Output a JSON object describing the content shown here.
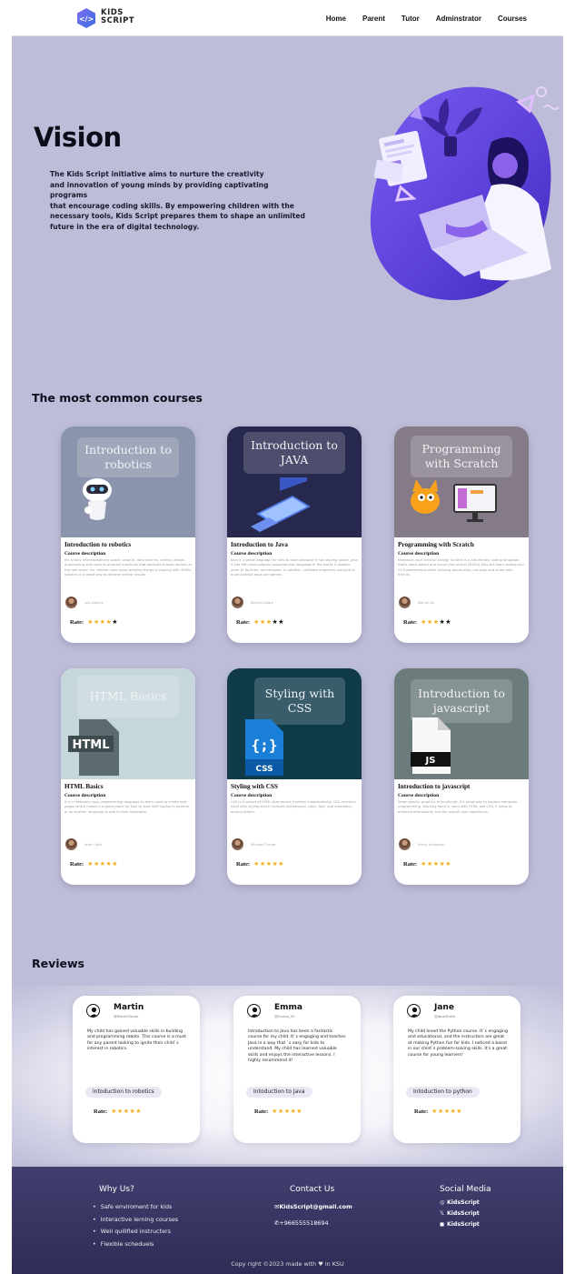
{
  "header": {
    "brand_line1": "KIDS",
    "brand_line2": "SCRIPT",
    "nav": [
      "Home",
      "Parent",
      "Tutor",
      "Adminstrator",
      "Courses"
    ]
  },
  "hero": {
    "title": "Vision",
    "text_lines": [
      "The Kids Script initiative aims to nurture the creativity",
      "and innovation of young minds by providing captivating",
      "programs",
      "that encourage coding skills. By empowering children with the",
      "necessary tools, Kids Script prepares them to shape an unlimited",
      "future in the era of digital technology."
    ]
  },
  "courses": {
    "section_title": "The most common courses",
    "items": [
      {
        "thumb_text": "Introduction to robotics",
        "title": "Introduction to robotics",
        "subtitle": "Course description",
        "description": "It's a truly interdisciplinary space using AI, data science, coding, design, engineering and more to produce machines that replicate human actions in the real world. For children who enjoy building things or playing with 3000s robotics is a great way to achieve similar results.",
        "author": "Leo Adams",
        "rate_label": "Rate:",
        "rating": 4,
        "thumb_color": "#8b94ad",
        "icon": "robot-icon"
      },
      {
        "thumb_text": "Introduction to JAVA",
        "title": "Introduction to Java",
        "subtitle": "Course description",
        "description": "Java is a great language for kids to learn because it has staying power. Java is the fifth most popular programming language in the world. It powers parts of YouTube, and Amazon. In addition, software engineers use Java to build Android apps and games.",
        "author": "Rachel Adam",
        "rate_label": "Rate:",
        "rating": 3,
        "thumb_color": "#26284e",
        "icon": "java-icon"
      },
      {
        "thumb_text": "Programming with Scratch",
        "title": "Programming with Scratch",
        "subtitle": "Course description",
        "description": "Introduce your child to coding! Scratch is a kid-friendly coding language that's block-based and visual (like virtual LEGOs) Kids will learn coding and CS fundamentals while building games they can play and share with friends.",
        "author": "Daniel Ali",
        "rate_label": "Rate:",
        "rating": 3,
        "thumb_color": "#847a88",
        "icon": "scratch-cat-icon"
      },
      {
        "thumb_text": "HTML Basics",
        "title": "HTML Basics",
        "subtitle": "Course description",
        "description": "It is a relatively easy programming language to learn used to create web pages which makes it a great place for kids to start with coding in general or as another language to add to their repertoire.",
        "author": "Jane Clark",
        "rate_label": "Rate:",
        "rating": 5,
        "thumb_color": "#c6d7dc",
        "icon": "html-file-icon"
      },
      {
        "thumb_text": "Styling with CSS",
        "title": "Styling with CSS",
        "subtitle": "Course description",
        "description": "CSS is a subset of HTML that cannot function independently. CSS concerns itself with styling which includes background, color, font, and animation, among others.",
        "author": "Michael Turner",
        "rate_label": "Rate:",
        "rating": 5,
        "thumb_color": "#0e3a4a",
        "icon": "css-file-icon"
      },
      {
        "thumb_text": "Introduction to javascript",
        "title": "Introduction to javascript",
        "subtitle": "Course description",
        "description": "Draw colorful graphics in JavaScript, it's great way to explore computer programming. Working hand in hand with HTML and CSS, it helps to enhance interactivity and the overall user experience.",
        "author": "Emily Anderson",
        "rate_label": "Rate:",
        "rating": 5,
        "thumb_color": "#6c7c7c",
        "icon": "js-file-icon"
      }
    ]
  },
  "reviews": {
    "section_title": "Reviews",
    "items": [
      {
        "name": "Martin",
        "handle": "@MartinTurner",
        "text": "My child has gained valuable skills in building and programming robots. This course is a must for any parent looking to ignite their child`s interest in robotics.",
        "course": "Intoduction to robotics",
        "rate_label": "Rate:",
        "rating": 5
      },
      {
        "name": "Emma",
        "handle": "@Emma_92",
        "text": "Introduction to Java has been a fantastic course for my child. It`s engaging and teaches Java in a way that `s easy for kids to understand. My child has learned valuable skills and enjoys the interactive lessons. I highly recommend it!",
        "course": "Intoduction to Java",
        "rate_label": "Rate:",
        "rating": 5
      },
      {
        "name": "Jane",
        "handle": "@JaneSmith",
        "text": "My child loved the Python course. It`s engaging and educational, and the instructors are great at making Python fun for kids. I noticed a boost in our child`s problem-solving skills. It's a great course for young learners!",
        "course": "Intoduction to python",
        "rate_label": "Rate:",
        "rating": 5
      }
    ]
  },
  "footer": {
    "why_title": "Why Us?",
    "why_items": [
      "Safe enviroment for kids",
      "Interactive lerning courses",
      "Well quilified instructers",
      "Flexible scheduels"
    ],
    "contact_title": "Contact Us",
    "email": "KidsScript@gmail.com",
    "phone": "+966555518694",
    "social_title": "Social Media",
    "social": [
      {
        "icon": "instagram-icon",
        "label": "KidsScript"
      },
      {
        "icon": "x-icon",
        "label": "KidsScript"
      },
      {
        "icon": "facebook-icon",
        "label": "KidsScript"
      }
    ],
    "copyright_left": "Copy right ©2023 made with",
    "copyright_right": "in KSU"
  },
  "colors": {
    "page_bg": "#bdbdd9",
    "footer_bg": "#2f2c57",
    "accent_purple": "#5b3fd6",
    "star": "#f2b01e"
  }
}
